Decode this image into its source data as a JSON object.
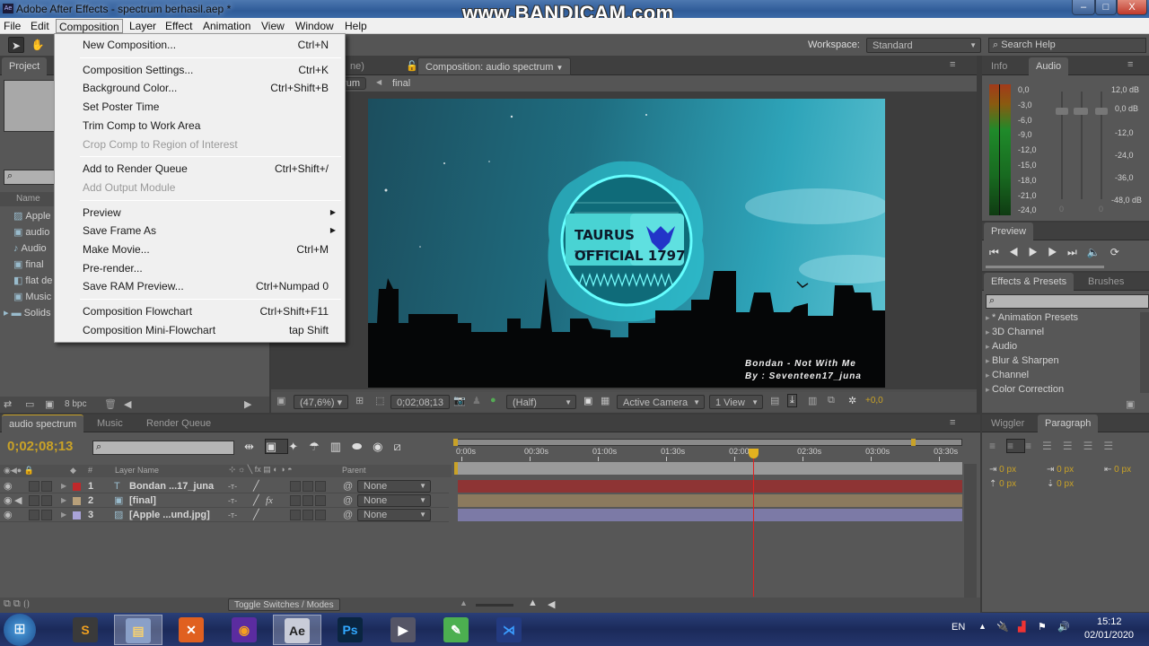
{
  "window": {
    "title": "Adobe After Effects - spectrum berhasil.aep *",
    "app_icon_label": "Ae",
    "watermark": "www.BANDICAM.com",
    "controls": {
      "minimize": "–",
      "maximize": "□",
      "close": "X"
    }
  },
  "menubar": [
    "File",
    "Edit",
    "Composition",
    "Layer",
    "Effect",
    "Animation",
    "View",
    "Window",
    "Help"
  ],
  "composition_menu": {
    "groups": [
      [
        {
          "label": "New Composition...",
          "shortcut": "Ctrl+N"
        }
      ],
      [
        {
          "label": "Composition Settings...",
          "shortcut": "Ctrl+K"
        },
        {
          "label": "Background Color...",
          "shortcut": "Ctrl+Shift+B"
        },
        {
          "label": "Set Poster Time",
          "shortcut": ""
        },
        {
          "label": "Trim Comp to Work Area",
          "shortcut": ""
        },
        {
          "label": "Crop Comp to Region of Interest",
          "shortcut": "",
          "disabled": true
        }
      ],
      [
        {
          "label": "Add to Render Queue",
          "shortcut": "Ctrl+Shift+/"
        },
        {
          "label": "Add Output Module",
          "shortcut": "",
          "disabled": true
        }
      ],
      [
        {
          "label": "Preview",
          "shortcut": "",
          "submenu": true
        },
        {
          "label": "Save Frame As",
          "shortcut": "",
          "submenu": true
        },
        {
          "label": "Make Movie...",
          "shortcut": "Ctrl+M"
        },
        {
          "label": "Pre-render...",
          "shortcut": ""
        },
        {
          "label": "Save RAM Preview...",
          "shortcut": "Ctrl+Numpad 0"
        }
      ],
      [
        {
          "label": "Composition Flowchart",
          "shortcut": "Ctrl+Shift+F11"
        },
        {
          "label": "Composition Mini-Flowchart",
          "shortcut": "tap Shift"
        }
      ]
    ]
  },
  "toolbar": {
    "workspace_label": "Workspace:",
    "workspace_value": "Standard",
    "search_help_placeholder": "Search Help"
  },
  "project_panel": {
    "tab": "Project",
    "column_name": "Name",
    "items": [
      {
        "name": "Apple",
        "icon": "image-icon"
      },
      {
        "name": "audio",
        "icon": "composition-icon"
      },
      {
        "name": "Audio",
        "icon": "audio-file-icon"
      },
      {
        "name": "final",
        "icon": "composition-icon"
      },
      {
        "name": "flat de",
        "icon": "psd-icon"
      },
      {
        "name": "Music",
        "icon": "composition-icon"
      },
      {
        "name": "Solids",
        "icon": "folder-icon"
      }
    ],
    "bpc": "8 bpc"
  },
  "composition_panel": {
    "hidden_tab": "ne)",
    "tab": "Composition: audio spectrum",
    "breadcrumbs": [
      "trum",
      "final"
    ],
    "zoom": "(47,6%)",
    "timecode": "0;02;08;13",
    "resolution": "(Half)",
    "camera": "Active Camera",
    "views": "1 View",
    "exposure": "+0,0",
    "frame": {
      "logo_line1": "TAURUS",
      "logo_line2": "OFFICIAL 1797",
      "credit_line1": "Bondan - Not With Me",
      "credit_line2": "By : Seventeen17_juna"
    }
  },
  "info_audio_panel": {
    "tabs": [
      "Info",
      "Audio"
    ],
    "left_scale": [
      "0,0",
      "-3,0",
      "-6,0",
      "-9,0",
      "-12,0",
      "-15,0",
      "-18,0",
      "-21,0",
      "-24,0"
    ],
    "right_scale": [
      "12,0 dB",
      "0,0 dB",
      "-12,0",
      "-24,0",
      "-36,0",
      "-48,0 dB"
    ],
    "slider_values": [
      "0",
      "0"
    ]
  },
  "preview_panel": {
    "tab": "Preview"
  },
  "effects_panel": {
    "tabs": [
      "Effects & Presets",
      "Brushes"
    ],
    "items": [
      "* Animation Presets",
      "3D Channel",
      "Audio",
      "Blur & Sharpen",
      "Channel",
      "Color Correction"
    ]
  },
  "paragraph_panel": {
    "tabs": [
      "Wiggler",
      "Paragraph"
    ],
    "values": [
      "0 px",
      "0 px",
      "0 px",
      "0 px",
      "0 px"
    ]
  },
  "timeline": {
    "tabs": [
      "audio spectrum",
      "Music",
      "Render Queue"
    ],
    "current_time": "0;02;08;13",
    "columns": {
      "layer_name": "Layer Name",
      "parent": "Parent",
      "number": "#"
    },
    "layers": [
      {
        "num": "1",
        "name": "Bondan ...17_juna",
        "color": "#c0282a",
        "type": "text-layer-icon",
        "parent": "None",
        "bar_color": "#8e3434"
      },
      {
        "num": "2",
        "name": "[final]",
        "color": "#b8a07a",
        "type": "composition-icon",
        "parent": "None",
        "bar_color": "#8b7a5e",
        "fx": "fx"
      },
      {
        "num": "3",
        "name": "[Apple ...und.jpg]",
        "color": "#a9a3d8",
        "type": "image-icon",
        "parent": "None",
        "bar_color": "#7c7aa6"
      }
    ],
    "ruler": [
      "0:00s",
      "00:30s",
      "01:00s",
      "01:30s",
      "02:00s",
      "02:30s",
      "03:00s",
      "03:30s"
    ],
    "toggle_label": "Toggle Switches / Modes",
    "playhead_time_seconds": 128.4
  },
  "taskbar": {
    "apps": [
      "Sublime Text",
      "File Explorer",
      "XAMPP",
      "Avast Browser",
      "After Effects",
      "Photoshop",
      "Game",
      "CorelDRAW",
      "VS Code"
    ],
    "language": "EN",
    "time": "15:12",
    "date": "02/01/2020"
  }
}
